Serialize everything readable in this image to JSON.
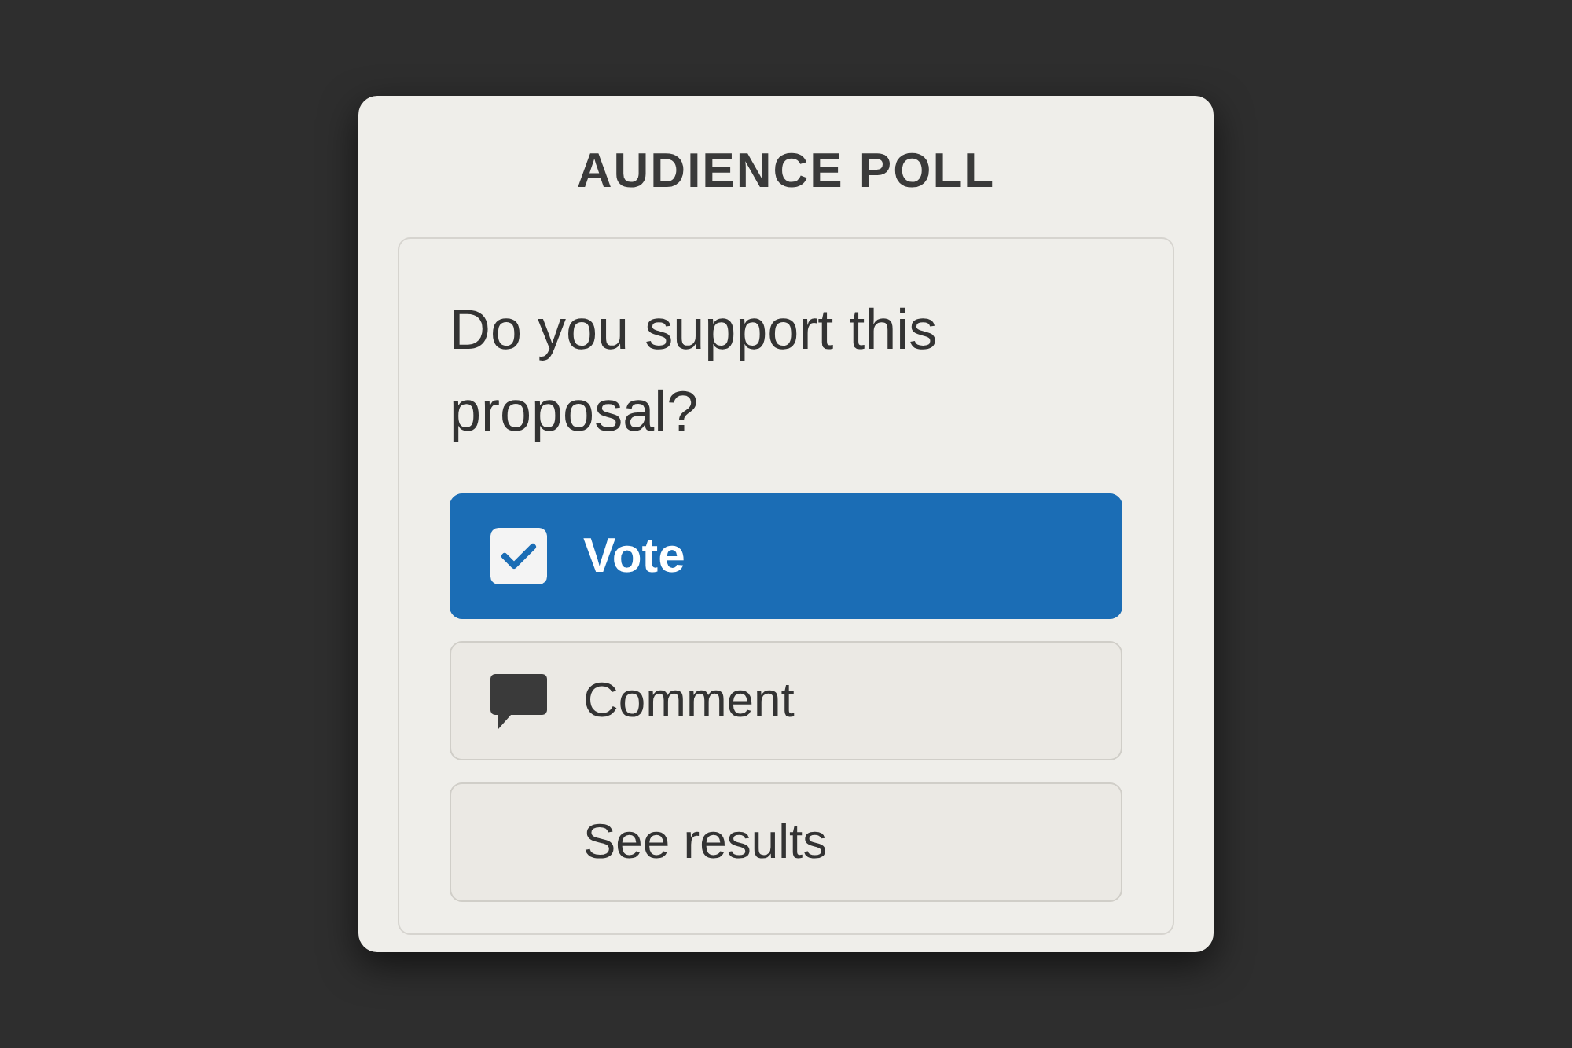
{
  "poll": {
    "title": "AUDIENCE POLL",
    "question": "Do you support this proposal?",
    "options": [
      {
        "label": "Vote",
        "kind": "check",
        "selected": true
      },
      {
        "label": "Comment",
        "kind": "comment",
        "selected": false
      },
      {
        "label": "See results",
        "kind": "plain",
        "selected": false
      }
    ]
  }
}
